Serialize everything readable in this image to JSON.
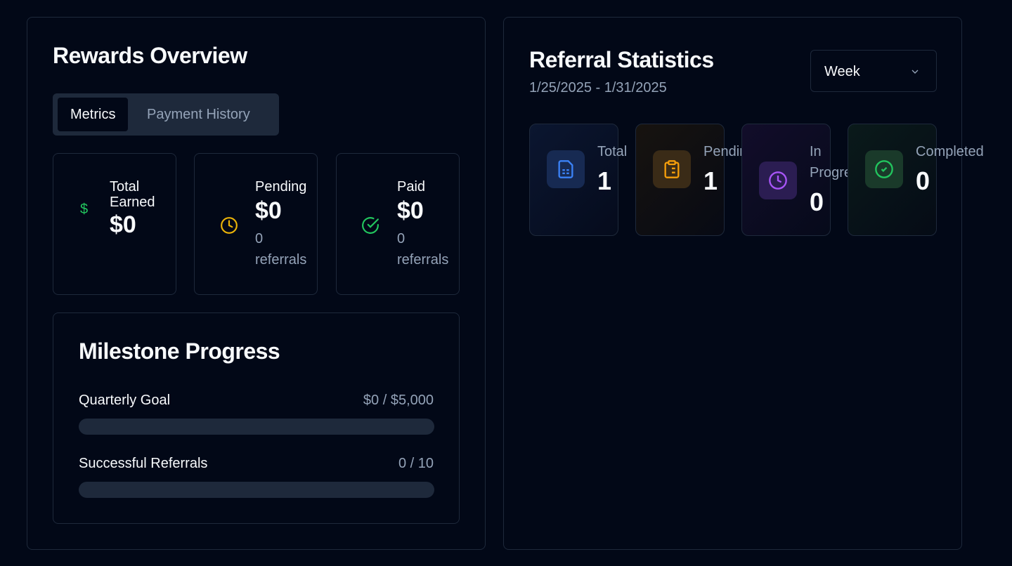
{
  "rewards": {
    "title": "Rewards Overview",
    "tabs": [
      {
        "label": "Metrics",
        "active": true
      },
      {
        "label": "Payment History",
        "active": false
      }
    ],
    "metrics": [
      {
        "label": "Total Earned",
        "value": "$0",
        "icon": "dollar-icon",
        "color": "#22c55e"
      },
      {
        "label": "Pending",
        "value": "$0",
        "sub": "0 referrals",
        "icon": "clock-icon",
        "color": "#eab308"
      },
      {
        "label": "Paid",
        "value": "$0",
        "sub": "0 referrals",
        "icon": "check-circle-icon",
        "color": "#22c55e"
      }
    ],
    "milestone": {
      "title": "Milestone Progress",
      "rows": [
        {
          "label": "Quarterly Goal",
          "value": "$0 / $5,000",
          "progress": 0
        },
        {
          "label": "Successful Referrals",
          "value": "0 / 10",
          "progress": 0
        }
      ]
    }
  },
  "referral": {
    "title": "Referral Statistics",
    "date_range": "1/25/2025 - 1/31/2025",
    "period": "Week",
    "stats": [
      {
        "label": "Total",
        "value": "1",
        "icon": "file-text-icon",
        "color": "#3b82f6"
      },
      {
        "label": "Pending",
        "value": "1",
        "icon": "clipboard-list-icon",
        "color": "#f59e0b"
      },
      {
        "label": "In Progress",
        "value": "0",
        "icon": "clock-icon",
        "color": "#a855f7"
      },
      {
        "label": "Completed",
        "value": "0",
        "icon": "check-circle-icon",
        "color": "#22c55e"
      }
    ]
  }
}
